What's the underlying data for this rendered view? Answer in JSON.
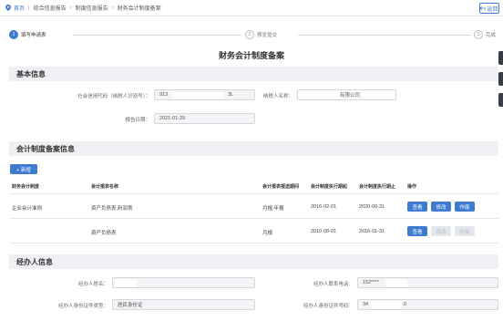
{
  "breadcrumb": {
    "home": "首页",
    "items": [
      "综合信息报告",
      "制度信息报告",
      "财务会计制度备案"
    ],
    "back_label": "返回"
  },
  "steps": [
    {
      "num": "1",
      "label": "填写申请表",
      "active": true
    },
    {
      "num": "2",
      "label": "预览提交",
      "active": false
    },
    {
      "num": "3",
      "label": "完成",
      "active": false
    }
  ],
  "page_title": "财务会计制度备案",
  "basic_info": {
    "section_title": "基本信息",
    "credit_code_label": "社会信用代码（纳税人识别号）：",
    "credit_code_value_start": "913",
    "credit_code_value_end": "3L",
    "taxpayer_name_label": "纳税人名称：",
    "taxpayer_name_value": "有限公司",
    "report_date_label": "报告日期：",
    "report_date_value": "2021-01-29"
  },
  "accounting_system": {
    "section_title": "会计制度备案信息",
    "add_button": "+ 新增",
    "columns": [
      "财务会计制度",
      "会计报表名称",
      "会计报表报送期间",
      "会计制度执行期起",
      "会计制度执行期止",
      "操作"
    ],
    "rows": [
      {
        "system": "企业会计准则",
        "report_name": "资产负债表,利润表",
        "period": "月报,年报",
        "start": "2016-02-01",
        "end": "2020-06-31",
        "actions": [
          {
            "label": "查看",
            "enabled": true
          },
          {
            "label": "修改",
            "enabled": true
          },
          {
            "label": "作废",
            "enabled": true
          }
        ]
      },
      {
        "system": "",
        "report_name": "资产负债表",
        "period": "月报",
        "start": "2010-08-01",
        "end": "2016-01-31",
        "actions": [
          {
            "label": "查看",
            "enabled": true
          },
          {
            "label": "修改",
            "enabled": false
          },
          {
            "label": "作废",
            "enabled": false
          }
        ]
      }
    ]
  },
  "agent_info": {
    "section_title": "经办人信息",
    "name_label": "经办人姓名：",
    "name_value": "",
    "phone_label": "经办人联系电话：",
    "phone_value": "152****",
    "id_type_label": "经办人身份证件类型：",
    "id_type_value": "居民身份证",
    "id_number_label": "经办人身份证件号码：",
    "id_number_value_start": "34",
    "id_number_value_end": "0"
  },
  "colors": {
    "primary": "#3e7bd1",
    "section_bg": "#eef0f3"
  }
}
